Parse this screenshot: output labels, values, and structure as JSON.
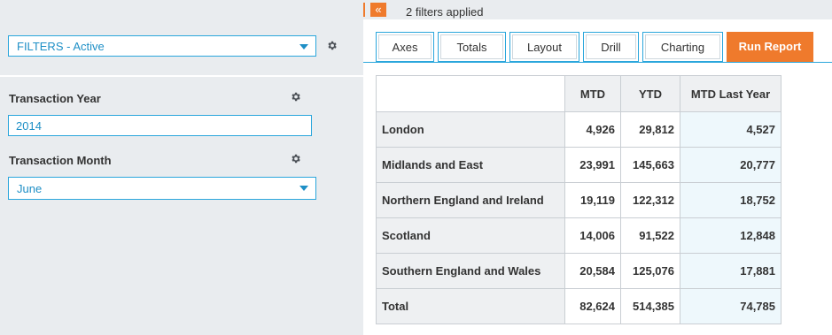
{
  "top_strip": {
    "lock_glyph": "🔒",
    "collapse_glyph": "«",
    "filters_applied": "2 filters applied"
  },
  "sidebar": {
    "filter_set_label": "FILTERS - Active",
    "fields": [
      {
        "label": "Transaction Year",
        "value": "2014"
      },
      {
        "label": "Transaction Month",
        "value": "June"
      }
    ]
  },
  "tabs": [
    {
      "label": "Axes"
    },
    {
      "label": "Totals"
    },
    {
      "label": "Layout"
    },
    {
      "label": "Drill"
    },
    {
      "label": "Charting"
    }
  ],
  "run_report_label": "Run Report",
  "table": {
    "columns": [
      "",
      "MTD",
      "YTD",
      "MTD Last Year"
    ],
    "rows": [
      {
        "label": "London",
        "mtd": "4,926",
        "ytd": "29,812",
        "mtd_ly": "4,527"
      },
      {
        "label": "Midlands and East",
        "mtd": "23,991",
        "ytd": "145,663",
        "mtd_ly": "20,777"
      },
      {
        "label": "Northern England and Ireland",
        "mtd": "19,119",
        "ytd": "122,312",
        "mtd_ly": "18,752"
      },
      {
        "label": "Scotland",
        "mtd": "14,006",
        "ytd": "91,522",
        "mtd_ly": "12,848"
      },
      {
        "label": "Southern England and Wales",
        "mtd": "20,584",
        "ytd": "125,076",
        "mtd_ly": "17,881"
      },
      {
        "label": "Total",
        "mtd": "82,624",
        "ytd": "514,385",
        "mtd_ly": "74,785"
      }
    ]
  },
  "colors": {
    "accent_blue": "#2aa6dc",
    "accent_orange": "#ef7a2c",
    "panel_bg": "#e9ecef"
  }
}
